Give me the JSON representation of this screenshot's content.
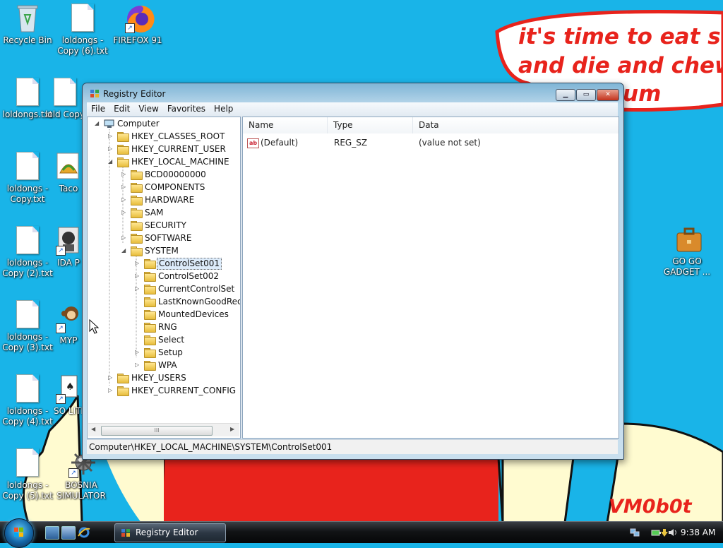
{
  "wallpaper": {
    "message_lines": [
      "it's time to eat shit",
      "and die and chew",
      "um"
    ],
    "signature": "VM0b0t",
    "colors": {
      "sky": "#19b4e8",
      "text": "#e8231c",
      "bubble": "#ffffff",
      "shirt": "#e8231c",
      "skin": "#fffbd0"
    }
  },
  "desktop_icons": [
    {
      "id": "recycle",
      "label": "Recycle Bin",
      "icon": "recycle-bin-icon"
    },
    {
      "id": "copy6",
      "label": "loldongs - Copy (6).txt",
      "icon": "text-file-icon"
    },
    {
      "id": "firefox",
      "label": "FIREFOX 91",
      "icon": "firefox-icon"
    },
    {
      "id": "loldongs",
      "label": "loldongs.txt",
      "icon": "text-file-icon"
    },
    {
      "id": "lolcopy",
      "label": "lold Copy",
      "icon": "text-file-icon"
    },
    {
      "id": "copy1",
      "label": "loldongs - Copy.txt",
      "icon": "text-file-icon"
    },
    {
      "id": "taco",
      "label": "Taco",
      "icon": "taco-icon"
    },
    {
      "id": "copy2",
      "label": "loldongs - Copy (2).txt",
      "icon": "text-file-icon"
    },
    {
      "id": "ida",
      "label": "IDA P",
      "icon": "ida-pro-icon"
    },
    {
      "id": "copy3",
      "label": "loldongs - Copy (3).txt",
      "icon": "text-file-icon"
    },
    {
      "id": "myp",
      "label": "MYP",
      "icon": "monkey-icon"
    },
    {
      "id": "copy4",
      "label": "loldongs - Copy (4).txt",
      "icon": "text-file-icon"
    },
    {
      "id": "soli",
      "label": "SO LITI",
      "icon": "solitaire-icon"
    },
    {
      "id": "copy5",
      "label": "loldongs - Copy (5).txt",
      "icon": "text-file-icon"
    },
    {
      "id": "bosnia",
      "label": "BOSNIA SIMULATOR",
      "icon": "mine-icon"
    },
    {
      "id": "gadget",
      "label": "GO GO GADGET ...",
      "icon": "briefcase-icon"
    }
  ],
  "window": {
    "title": "Registry Editor",
    "menu": [
      "File",
      "Edit",
      "View",
      "Favorites",
      "Help"
    ],
    "tree": {
      "root": "Computer",
      "hives": {
        "classes_root": "HKEY_CLASSES_ROOT",
        "current_user": "HKEY_CURRENT_USER",
        "local_machine": "HKEY_LOCAL_MACHINE",
        "users": "HKEY_USERS",
        "current_config": "HKEY_CURRENT_CONFIG"
      },
      "hklm_children": [
        "BCD00000000",
        "COMPONENTS",
        "HARDWARE",
        "SAM",
        "SECURITY",
        "SOFTWARE",
        "SYSTEM"
      ],
      "system_children": [
        "ControlSet001",
        "ControlSet002",
        "CurrentControlSet",
        "LastKnownGoodReco",
        "MountedDevices",
        "RNG",
        "Select",
        "Setup",
        "WPA"
      ],
      "selected": "ControlSet001",
      "scroll_thumb": "III"
    },
    "list": {
      "columns": [
        "Name",
        "Type",
        "Data"
      ],
      "rows": [
        {
          "name": "(Default)",
          "type": "REG_SZ",
          "data": "(value not set)",
          "icon_text": "ab"
        }
      ]
    },
    "status_path": "Computer\\HKEY_LOCAL_MACHINE\\SYSTEM\\ControlSet001"
  },
  "taskbar": {
    "task_label": "Registry Editor",
    "clock": "9:38 AM",
    "quick_launch": [
      "show-desktop-icon",
      "switch-windows-icon",
      "internet-explorer-icon"
    ],
    "tray_icons": [
      "network-icon",
      "battery-icon",
      "power-icon",
      "volume-icon"
    ]
  }
}
